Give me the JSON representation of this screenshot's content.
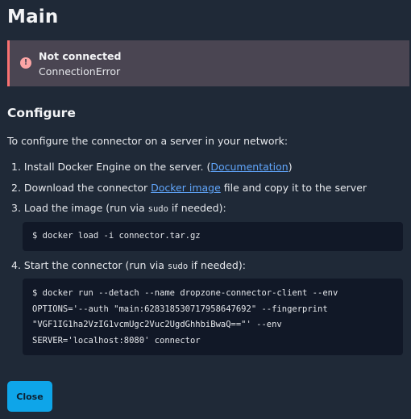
{
  "page": {
    "title": "Main"
  },
  "alert": {
    "icon": "exclamation-icon",
    "title": "Not connected",
    "message": "ConnectionError",
    "accent": "#f87171",
    "background": "#4a4552"
  },
  "configure": {
    "heading": "Configure",
    "intro": "To configure the connector on a server in your network:",
    "steps": [
      {
        "num": "1.",
        "before": "Install Docker Engine on the server. (",
        "link": "Documentation",
        "after": ")"
      },
      {
        "num": "2.",
        "before": "Download the connector ",
        "link": "Docker image",
        "after": " file and copy it to the server"
      },
      {
        "num": "3.",
        "before": "Load the image (run via ",
        "code": "sudo",
        "after": " if needed):"
      },
      {
        "num": "4.",
        "before": "Start the connector (run via ",
        "code": "sudo",
        "after": " if needed):"
      }
    ],
    "load_command": "$ docker load -i connector.tar.gz",
    "run_command": [
      "$ docker run --detach --name dropzone-connector-client --env",
      "OPTIONS='--auth \"main:628318530717958647692\" --fingerprint",
      "\"VGF1IG1ha2VzIG1vcmUgc2Vuc2UgdGhhbiBwaQ==\"' --env",
      "SERVER='localhost:8080' connector"
    ]
  },
  "footer": {
    "close_label": "Close",
    "accent": "#0ea5e9"
  }
}
